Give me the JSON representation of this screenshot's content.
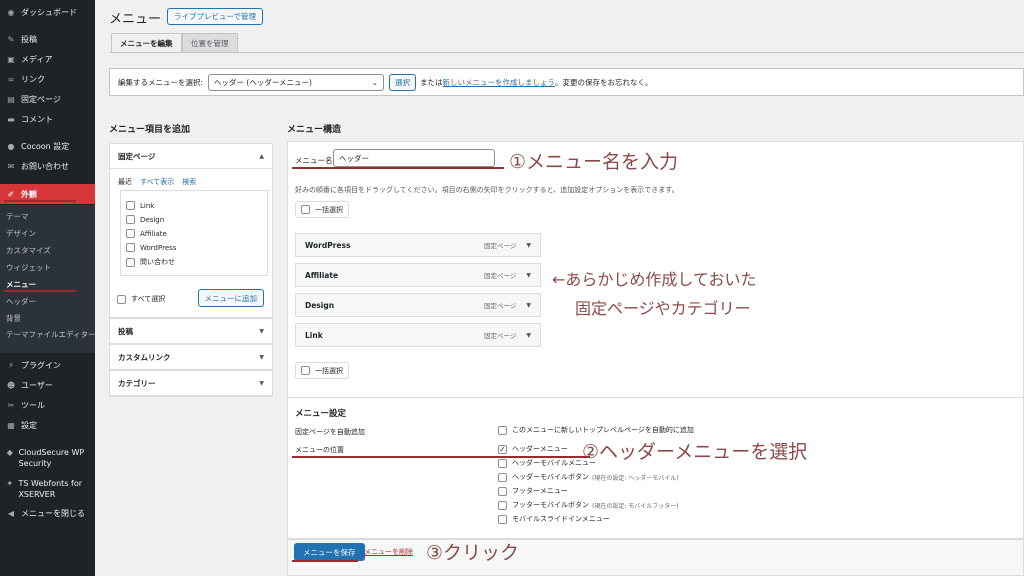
{
  "sidebar": {
    "items": [
      {
        "label": "ダッシュボード",
        "icon": "dashboard-icon"
      },
      {
        "label": "投稿",
        "icon": "pin-icon"
      },
      {
        "label": "メディア",
        "icon": "media-icon"
      },
      {
        "label": "リンク",
        "icon": "link-icon"
      },
      {
        "label": "固定ページ",
        "icon": "page-icon"
      },
      {
        "label": "コメント",
        "icon": "comment-icon"
      },
      {
        "label": "Cocoon 設定",
        "icon": "cocoon-icon"
      },
      {
        "label": "お問い合わせ",
        "icon": "mail-icon"
      },
      {
        "label": "外観",
        "icon": "appearance-icon"
      },
      {
        "label": "プラグイン",
        "icon": "plugin-icon"
      },
      {
        "label": "ユーザー",
        "icon": "user-icon"
      },
      {
        "label": "ツール",
        "icon": "wrench-icon"
      },
      {
        "label": "設定",
        "icon": "settings-icon"
      },
      {
        "label": "CloudSecure WP Security",
        "icon": "shield-icon"
      },
      {
        "label": "TS Webfonts for XSERVER",
        "icon": "font-icon"
      },
      {
        "label": "メニューを閉じる",
        "icon": "collapse-icon"
      }
    ],
    "submenu": [
      "テーマ",
      "デザイン",
      "カスタマイズ",
      "ウィジェット",
      "メニュー",
      "ヘッダー",
      "背景",
      "テーマファイルエディター"
    ]
  },
  "header": {
    "title": "メニュー",
    "live_preview": "ライブプレビューで管理"
  },
  "tabs": [
    "メニューを編集",
    "位置を管理"
  ],
  "select_bar": {
    "label": "編集するメニューを選択:",
    "selected": "ヘッダー (ヘッダーメニュー)",
    "button": "選択",
    "or_text": "または",
    "new_link": "新しいメニューを作成しましょう",
    "suffix": "。変更の保存をお忘れなく。"
  },
  "add_items": {
    "heading": "メニュー項目を追加",
    "fixed_pages": "固定ページ",
    "inner_tabs": [
      "最近",
      "すべて表示",
      "検索"
    ],
    "pages": [
      "Link",
      "Design",
      "Affiliate",
      "WordPress",
      "問い合わせ"
    ],
    "select_all": "すべて選択",
    "add_button": "メニューに追加",
    "sections": [
      "投稿",
      "カスタムリンク",
      "カテゴリー"
    ]
  },
  "structure": {
    "heading": "メニュー構造",
    "name_label": "メニュー名",
    "name_value": "ヘッダー",
    "hint": "好みの順番に各項目をドラッグしてください。項目の右側の矢印をクリックすると、追加設定オプションを表示できます。",
    "bulk_select": "一括選択",
    "type_label": "固定ページ",
    "items": [
      "WordPress",
      "Affiliate",
      "Design",
      "Link"
    ]
  },
  "settings": {
    "heading": "メニュー設定",
    "auto_add_label": "固定ページを自動追加",
    "auto_add_option": "このメニューに新しいトップレベルページを自動的に追加",
    "location_label": "メニューの位置",
    "locations": [
      {
        "label": "ヘッダーメニュー",
        "note": "",
        "checked": true
      },
      {
        "label": "ヘッダーモバイルメニュー",
        "note": "",
        "checked": false
      },
      {
        "label": "ヘッダーモバイルボタン",
        "note": "(現在の設定: ヘッダーモバイル)",
        "checked": false
      },
      {
        "label": "フッターメニュー",
        "note": "",
        "checked": false
      },
      {
        "label": "フッターモバイルボタン",
        "note": "(現在の設定: モバイルフッター)",
        "checked": false
      },
      {
        "label": "モバイルスライドインメニュー",
        "note": "",
        "checked": false
      }
    ]
  },
  "footer": {
    "save": "メニューを保存",
    "delete": "メニューを削除"
  },
  "annotations": {
    "a1": "①メニュー名を入力",
    "a2_line1": "←あらかじめ作成しておいた",
    "a2_line2": "固定ページやカテゴリー",
    "a3": "②ヘッダーメニューを選択",
    "a4": "③クリック",
    "color": "#9b2c2c"
  },
  "colors": {
    "sidebar_bg": "#1d2327",
    "active_menu": "#d63638",
    "primary": "#2271b1"
  }
}
